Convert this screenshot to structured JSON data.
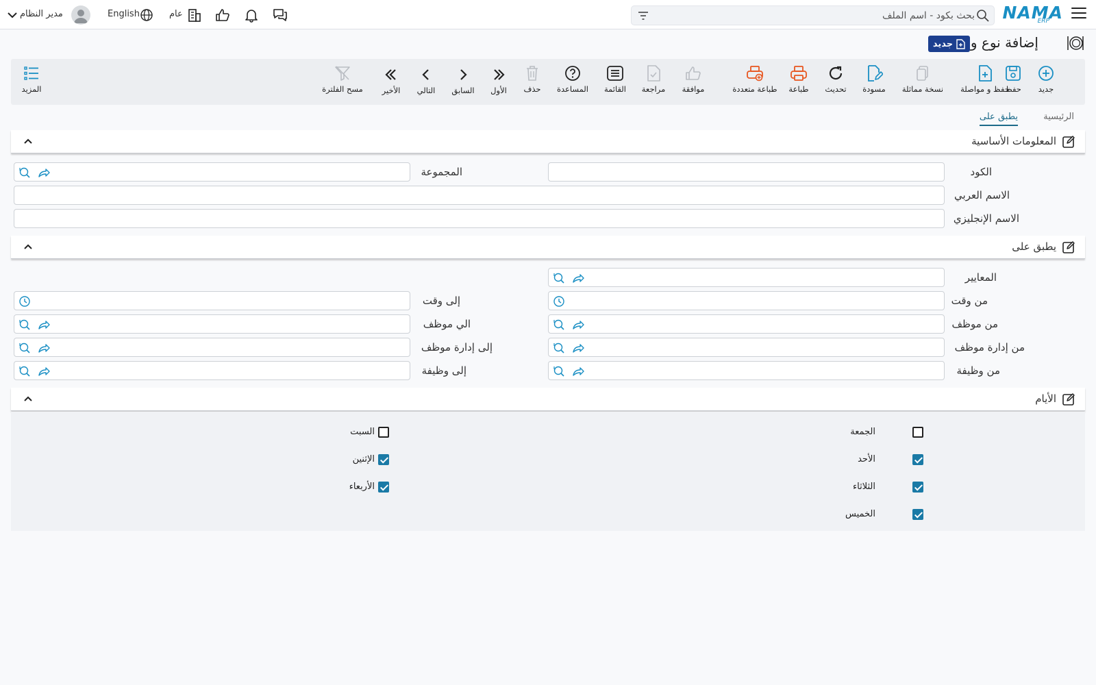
{
  "topbar": {
    "logo_text": "NAMA",
    "logo_sub": "ERP",
    "search_placeholder": "بحث بكود - اسم الملف",
    "company": "عام",
    "language": "English",
    "user": "مدير النظام"
  },
  "page": {
    "title": "إضافة نوع وجبة",
    "new_badge": "جديد"
  },
  "toolbar": {
    "new": "جديد",
    "save": "حفظ",
    "save_continue": "حفظ و مواصلة",
    "duplicate": "نسخة مماثلة",
    "draft": "مسودة",
    "refresh": "تحديث",
    "print": "طباعة",
    "multi_print": "طباعة متعددة",
    "approve": "موافقة",
    "review": "مراجعة",
    "list": "القائمة",
    "help": "المساعدة",
    "delete": "حذف",
    "first": "الأول",
    "previous": "السابق",
    "next": "التالي",
    "last": "الأخير",
    "clear_filter": "مسح الفلترة",
    "more": "المزيد"
  },
  "tabs": {
    "main": "الرئيسية",
    "applies_to": "يطبق على"
  },
  "basic_info": {
    "title": "المعلومات الأساسية",
    "code_label": "الكود",
    "group_label": "المجموعة",
    "arabic_name_label": "الاسم العربي",
    "english_name_label": "الاسم الإنجليزي"
  },
  "applies_to": {
    "title": "يطبق على",
    "criteria_label": "المعايير",
    "from_time_label": "من وقت",
    "to_time_label": "إلى وقت",
    "from_employee_label": "من موظف",
    "to_employee_label": "الي موظف",
    "from_emp_dept_label": "من إدارة موظف",
    "to_emp_dept_label": "إلى إدارة موظف",
    "from_job_label": "من وظيفة",
    "to_job_label": "إلى وظيفة"
  },
  "days": {
    "title": "الأيام",
    "friday": "الجمعة",
    "saturday": "السبت",
    "sunday": "الأحد",
    "monday": "الإثنين",
    "tuesday": "الثلاثاء",
    "wednesday": "الأربعاء",
    "thursday": "الخميس",
    "checked": {
      "friday": false,
      "saturday": false,
      "sunday": true,
      "monday": true,
      "tuesday": true,
      "wednesday": true,
      "thursday": true
    }
  },
  "colors": {
    "accent": "#1a8fc4",
    "orange": "#e8561f",
    "badge": "#1c3f8f",
    "checkbox": "#1a7aa6"
  }
}
